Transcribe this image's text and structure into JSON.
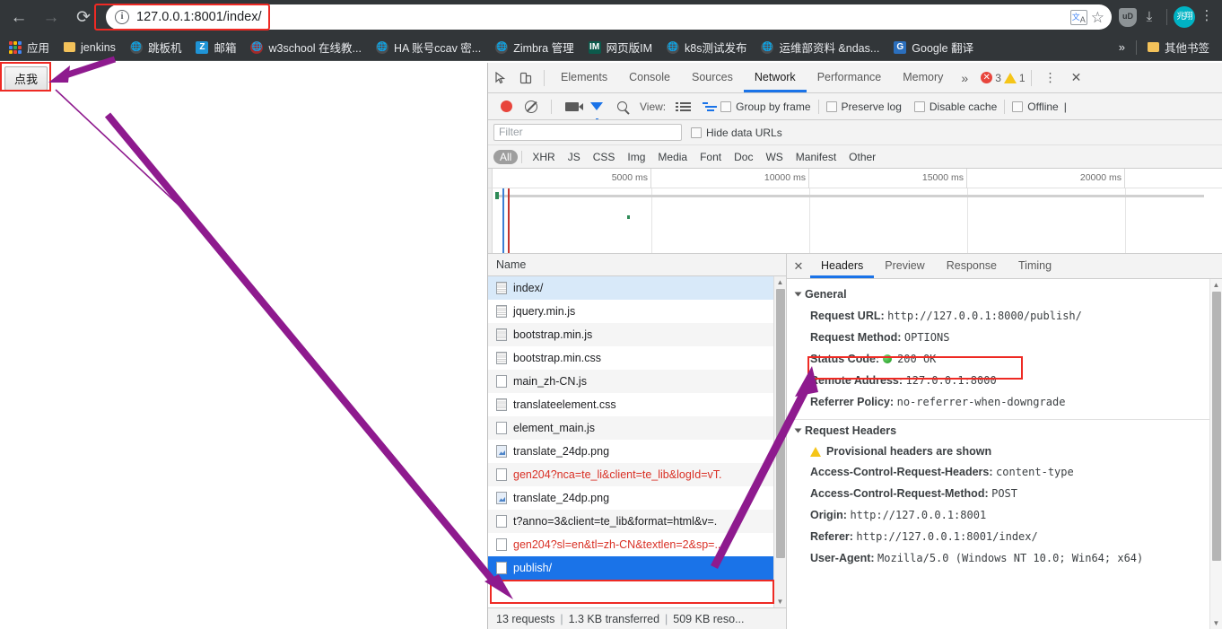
{
  "browser": {
    "nav": {
      "back": "←",
      "forward": "→",
      "reload": "⟳"
    },
    "url": "127.0.0.1:8001/index/",
    "info_icon": "ⓘ",
    "translate_icon": "translate-icon",
    "star_icon": "☆",
    "shield_label": "uD",
    "download_icon": "⤓",
    "avatar_label": "兆翔",
    "menu_icon": "⋮"
  },
  "bookmarks": {
    "items": [
      {
        "label": "应用",
        "icon": "apps-grid-icon"
      },
      {
        "label": "jenkins",
        "icon": "folder-icon"
      },
      {
        "label": "跳板机",
        "icon": "globe-icon"
      },
      {
        "label": "邮箱",
        "icon": "z-square-icon"
      },
      {
        "label": "w3school 在线教...",
        "icon": "globe-red-icon"
      },
      {
        "label": "HA 账号ccav 密...",
        "icon": "globe-icon"
      },
      {
        "label": "Zimbra 管理",
        "icon": "globe-icon"
      },
      {
        "label": "网页版IM",
        "icon": "im-square-icon"
      },
      {
        "label": "k8s测试发布",
        "icon": "globe-icon"
      },
      {
        "label": "运维部资料 &ndas...",
        "icon": "globe-icon"
      },
      {
        "label": "Google 翻译",
        "icon": "google-square-icon"
      }
    ],
    "overflow": "»",
    "other": {
      "label": "其他书签",
      "icon": "folder-icon"
    }
  },
  "page": {
    "click_button": "点我"
  },
  "devtools": {
    "inspect_icon": "inspect-element-icon",
    "device_icon": "device-toolbar-icon",
    "tabs": [
      {
        "label": "Elements",
        "active": false
      },
      {
        "label": "Console",
        "active": false
      },
      {
        "label": "Sources",
        "active": false
      },
      {
        "label": "Network",
        "active": true
      },
      {
        "label": "Performance",
        "active": false
      },
      {
        "label": "Memory",
        "active": false
      }
    ],
    "more_tabs": "»",
    "error_count": "3",
    "warning_count": "1",
    "settings_icon": "⋮",
    "close_icon": "✕",
    "toolbar": {
      "record_icon": "record-icon",
      "clear_icon": "clear-icon",
      "screenshot_icon": "camera-icon",
      "filter_icon": "funnel-icon",
      "search_icon": "search-icon",
      "view_label": "View:",
      "view_list_icon": "list-view-icon",
      "view_waterfall_icon": "waterfall-view-icon",
      "group_by_frame": "Group by frame",
      "preserve_log": "Preserve log",
      "disable_cache": "Disable cache",
      "offline": "Offline"
    },
    "filter": {
      "placeholder": "Filter",
      "value": "",
      "hide_data_urls": "Hide data URLs",
      "types": [
        "All",
        "XHR",
        "JS",
        "CSS",
        "Img",
        "Media",
        "Font",
        "Doc",
        "WS",
        "Manifest",
        "Other"
      ],
      "active_type": "All"
    },
    "overview": {
      "ticks": [
        "5000 ms",
        "10000 ms",
        "15000 ms",
        "20000 ms"
      ]
    },
    "requests": {
      "column_header": "Name",
      "rows": [
        {
          "name": "index/",
          "icon": "doc-icon",
          "state": "selected-light"
        },
        {
          "name": "jquery.min.js",
          "icon": "doc-icon",
          "state": "normal"
        },
        {
          "name": "bootstrap.min.js",
          "icon": "doc-icon",
          "state": "normal"
        },
        {
          "name": "bootstrap.min.css",
          "icon": "doc-icon",
          "state": "normal"
        },
        {
          "name": "main_zh-CN.js",
          "icon": "doc-white-icon",
          "state": "normal"
        },
        {
          "name": "translateelement.css",
          "icon": "doc-icon",
          "state": "normal"
        },
        {
          "name": "element_main.js",
          "icon": "doc-white-icon",
          "state": "normal"
        },
        {
          "name": "translate_24dp.png",
          "icon": "image-icon",
          "state": "normal"
        },
        {
          "name": "gen204?nca=te_li&client=te_lib&logId=vT.",
          "icon": "doc-white-icon",
          "state": "error"
        },
        {
          "name": "translate_24dp.png",
          "icon": "image-icon",
          "state": "normal"
        },
        {
          "name": "t?anno=3&client=te_lib&format=html&v=.",
          "icon": "doc-white-icon",
          "state": "normal"
        },
        {
          "name": "gen204?sl=en&tl=zh-CN&textlen=2&sp=..",
          "icon": "doc-white-icon",
          "state": "error"
        },
        {
          "name": "publish/",
          "icon": "doc-white-icon",
          "state": "selected-blue"
        }
      ],
      "status": {
        "requests": "13 requests",
        "transferred": "1.3 KB transferred",
        "resources": "509 KB reso..."
      }
    },
    "detail": {
      "close_icon": "✕",
      "tabs": [
        {
          "label": "Headers",
          "active": true
        },
        {
          "label": "Preview",
          "active": false
        },
        {
          "label": "Response",
          "active": false
        },
        {
          "label": "Timing",
          "active": false
        }
      ],
      "general": {
        "title": "General",
        "rows": [
          {
            "key": "Request URL:",
            "value": "http://127.0.0.1:8000/publish/"
          },
          {
            "key": "Request Method:",
            "value": "OPTIONS"
          },
          {
            "key": "Status Code:",
            "value": "200 OK",
            "status_dot": true
          },
          {
            "key": "Remote Address:",
            "value": "127.0.0.1:8000"
          },
          {
            "key": "Referrer Policy:",
            "value": "no-referrer-when-downgrade"
          }
        ]
      },
      "request_headers": {
        "title": "Request Headers",
        "provisional_notice": "Provisional headers are shown",
        "rows": [
          {
            "key": "Access-Control-Request-Headers:",
            "value": "content-type"
          },
          {
            "key": "Access-Control-Request-Method:",
            "value": "POST"
          },
          {
            "key": "Origin:",
            "value": "http://127.0.0.1:8001"
          },
          {
            "key": "Referer:",
            "value": "http://127.0.0.1:8001/index/"
          },
          {
            "key": "User-Agent:",
            "value": "Mozilla/5.0 (Windows NT 10.0; Win64; x64)"
          }
        ]
      }
    }
  },
  "annotations": {
    "highlight_color": "#ee2a24",
    "arrow_color": "#8e1a8e"
  }
}
